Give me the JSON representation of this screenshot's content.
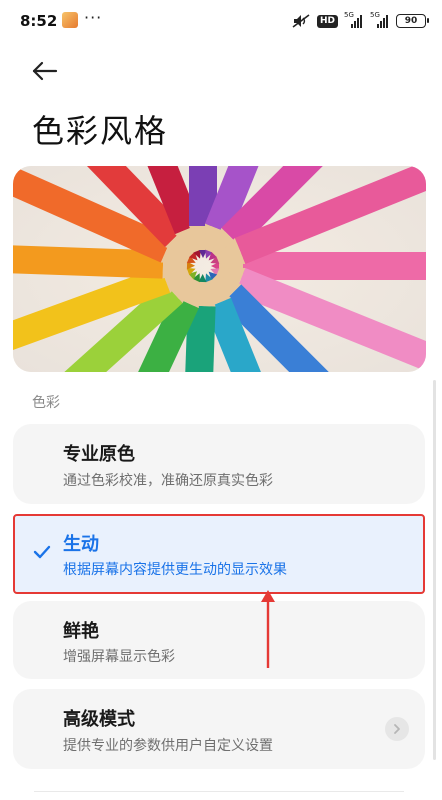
{
  "status_bar": {
    "time": "8:52",
    "more": "···",
    "hd": "HD",
    "signal1_tag": "5G",
    "signal2_tag": "5G",
    "battery": "90"
  },
  "header": {
    "title": "色彩风格"
  },
  "section": {
    "label": "色彩"
  },
  "options": [
    {
      "title": "专业原色",
      "desc": "通过色彩校准，准确还原真实色彩",
      "selected": false
    },
    {
      "title": "生动",
      "desc": "根据屏幕内容提供更生动的显示效果",
      "selected": true
    },
    {
      "title": "鲜艳",
      "desc": "增强屏幕显示色彩",
      "selected": false
    },
    {
      "title": "高级模式",
      "desc": "提供专业的参数供用户自定义设置",
      "selected": false
    }
  ],
  "colors": {
    "accent": "#1a73e8",
    "selected_bg": "#e9f1fd",
    "annotation": "#e53935",
    "card_bg": "#f5f5f5"
  },
  "icons": {
    "back": "arrow-left",
    "check": "checkmark",
    "chevron": "chevron-right"
  }
}
